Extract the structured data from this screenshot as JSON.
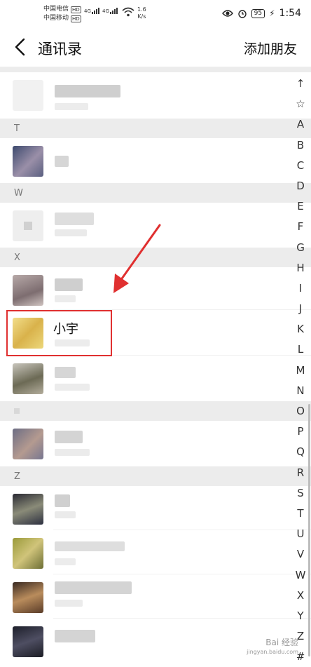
{
  "status_bar": {
    "carrier1": "中国电信",
    "carrier2": "中国移动",
    "hd": "HD",
    "net1": "4G",
    "net2": "4G",
    "speed_value": "1.6",
    "speed_unit": "K/s",
    "battery": "95",
    "time": "1:54"
  },
  "header": {
    "title": "通讯录",
    "add_friend": "添加朋友"
  },
  "sections": [
    "T",
    "W",
    "X",
    "",
    "Z"
  ],
  "highlighted_contact": "小宇",
  "index_letters": [
    "↑",
    "☆",
    "A",
    "B",
    "C",
    "D",
    "E",
    "F",
    "G",
    "H",
    "I",
    "J",
    "K",
    "L",
    "M",
    "N",
    "O",
    "P",
    "Q",
    "R",
    "S",
    "T",
    "U",
    "V",
    "W",
    "X",
    "Y",
    "Z",
    "#"
  ],
  "watermark": {
    "line1": "Bai 经验",
    "line2": "jingyan.baidu.com"
  },
  "colors": {
    "highlight_border": "#e03030",
    "section_bg": "#ececec"
  }
}
